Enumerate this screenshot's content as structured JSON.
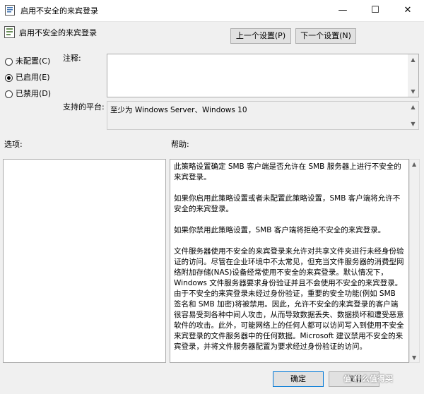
{
  "window": {
    "title": "启用不安全的来宾登录",
    "controls": {
      "minimize": "—",
      "maximize": "☐",
      "close": "✕"
    }
  },
  "header": {
    "policy_name": "启用不安全的来宾登录",
    "prev_button": "上一个设置(P)",
    "next_button": "下一个设置(N)"
  },
  "state": {
    "options": [
      {
        "label": "未配置(C)",
        "selected": false
      },
      {
        "label": "已启用(E)",
        "selected": true
      },
      {
        "label": "已禁用(D)",
        "selected": false
      }
    ]
  },
  "comment": {
    "label": "注释:",
    "value": ""
  },
  "supported": {
    "label": "支持的平台:",
    "value": "至少为 Windows Server、Windows 10"
  },
  "options_section": {
    "label": "选项:"
  },
  "help_section": {
    "label": "帮助:",
    "paragraphs": [
      "此策略设置确定 SMB 客户端是否允许在 SMB 服务器上进行不安全的来宾登录。",
      "如果你启用此策略设置或者未配置此策略设置，SMB 客户端将允许不安全的来宾登录。",
      "如果你禁用此策略设置，SMB 客户端将拒绝不安全的来宾登录。",
      "文件服务器使用不安全的来宾登录来允许对共享文件夹进行未经身份验证的访问。尽管在企业环境中不太常见，但充当文件服务器的消费型网络附加存储(NAS)设备经常使用不安全的来宾登录。默认情况下，Windows 文件服务器要求身份验证并且不会使用不安全的来宾登录。由于不安全的来宾登录未经过身份验证，重要的安全功能(例如 SMB 签名和 SMB 加密)将被禁用。因此，允许不安全的来宾登录的客户端很容易受到各种中间人攻击，从而导致数据丢失、数据损坏和遭受恶意软件的攻击。此外，可能网络上的任何人都可以访问写入到使用不安全来宾登录的文件服务器中的任何数据。Microsoft 建议禁用不安全的来宾登录，并将文件服务器配置为要求经过身份验证的访问。"
    ]
  },
  "footer": {
    "ok_button": "确定",
    "cancel_button": "取消"
  },
  "watermark": "值 什么值得买",
  "colors": {
    "title_bg": "#ffffff",
    "dialog_bg": "#f0f0f0",
    "text": "#000000"
  }
}
